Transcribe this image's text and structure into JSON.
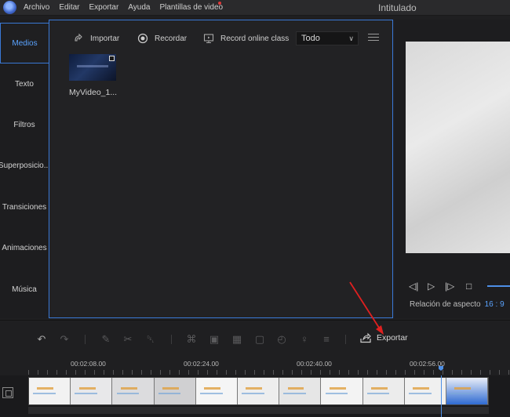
{
  "app": {
    "window_title": "Intitulado",
    "menu": [
      "Archivo",
      "Editar",
      "Exportar",
      "Ayuda",
      "Plantillas de video"
    ]
  },
  "sidebar": {
    "items": [
      {
        "label": "Medios",
        "active": true
      },
      {
        "label": "Texto",
        "active": false
      },
      {
        "label": "Filtros",
        "active": false
      },
      {
        "label": "Superposicio...",
        "active": false
      },
      {
        "label": "Transiciones",
        "active": false
      },
      {
        "label": "Animaciones",
        "active": false
      },
      {
        "label": "Música",
        "active": false
      }
    ]
  },
  "media": {
    "import_label": "Importar",
    "record_label": "Recordar",
    "record_online_label": "Record online class",
    "filter_value": "Todo",
    "items": [
      {
        "name": "MyVideo_1..."
      }
    ]
  },
  "preview": {
    "aspect_label": "Relación de aspecto",
    "aspect_value": "16 : 9"
  },
  "edit_toolbar": {
    "export_label": "Exportar"
  },
  "timeline": {
    "ruler": [
      "00:02:08.00",
      "00:02:24.00",
      "00:02:40.00",
      "00:02:56.00"
    ]
  },
  "colors": {
    "accent": "#3a79d6",
    "accent_text": "#5aa3ff",
    "annotation_arrow": "#e02020"
  }
}
